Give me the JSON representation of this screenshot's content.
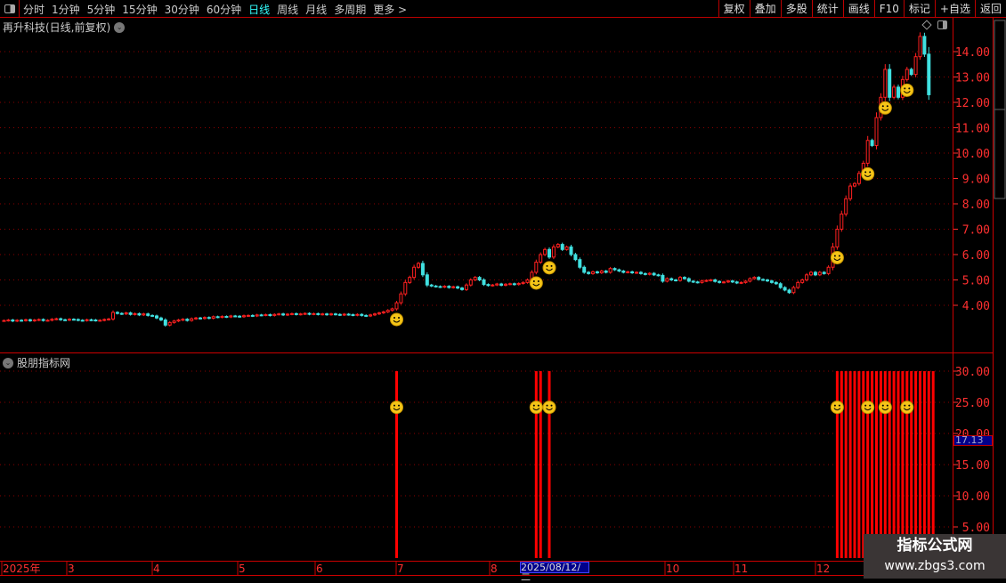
{
  "toolbar": {
    "periods": [
      "分时",
      "1分钟",
      "5分钟",
      "15分钟",
      "30分钟",
      "60分钟",
      "日线",
      "周线",
      "月线",
      "多周期",
      "更多 >"
    ],
    "active_period": "日线",
    "buttons": [
      "复权",
      "叠加",
      "多股",
      "统计",
      "画线",
      "F10",
      "标记",
      "+自选",
      "返回"
    ]
  },
  "main_pane": {
    "title": "再升科技(日线,前复权)",
    "price_axis": [
      "14.00",
      "13.00",
      "12.00",
      "11.00",
      "10.00",
      "9.00",
      "8.00",
      "7.00",
      "6.00",
      "5.00",
      "4.00"
    ],
    "colors": {
      "up": "#ff2020",
      "down": "#40e0e0",
      "grid": "#8b0000",
      "axis_text": "#ff3030"
    }
  },
  "indicator_pane": {
    "title": "股朋指标网",
    "axis": [
      "30.00",
      "25.00",
      "20.00",
      "15.00",
      "10.00",
      "5.00"
    ],
    "current_value": "17.13",
    "signal_value": 30,
    "bar_color": "#ff0000"
  },
  "x_axis": {
    "labels": [
      "2025年",
      "3",
      "4",
      "5",
      "6",
      "7",
      "8",
      "10",
      "11",
      "12"
    ],
    "cursor_date": "2025/08/12/二"
  },
  "watermark": {
    "name": "指标公式网",
    "url": "www.zbgs3.com"
  },
  "chart_data": {
    "type": "candlestick",
    "ylim": [
      3,
      15
    ],
    "closes": [
      3.4,
      3.42,
      3.38,
      3.41,
      3.4,
      3.43,
      3.39,
      3.42,
      3.44,
      3.4,
      3.41,
      3.45,
      3.47,
      3.43,
      3.42,
      3.45,
      3.44,
      3.41,
      3.4,
      3.43,
      3.42,
      3.4,
      3.41,
      3.44,
      3.46,
      3.72,
      3.68,
      3.66,
      3.7,
      3.64,
      3.67,
      3.62,
      3.66,
      3.6,
      3.58,
      3.5,
      3.42,
      3.22,
      3.32,
      3.38,
      3.42,
      3.45,
      3.4,
      3.47,
      3.5,
      3.48,
      3.52,
      3.49,
      3.55,
      3.53,
      3.56,
      3.54,
      3.58,
      3.57,
      3.55,
      3.59,
      3.6,
      3.58,
      3.62,
      3.61,
      3.63,
      3.6,
      3.64,
      3.66,
      3.62,
      3.65,
      3.67,
      3.64,
      3.66,
      3.68,
      3.65,
      3.67,
      3.64,
      3.66,
      3.63,
      3.66,
      3.64,
      3.62,
      3.65,
      3.63,
      3.61,
      3.64,
      3.6,
      3.58,
      3.62,
      3.66,
      3.7,
      3.74,
      3.8,
      3.86,
      4.1,
      4.45,
      4.9,
      5.1,
      5.5,
      5.65,
      5.2,
      4.8,
      4.76,
      4.74,
      4.72,
      4.75,
      4.7,
      4.73,
      4.68,
      4.62,
      4.8,
      5.0,
      5.1,
      5.0,
      4.82,
      4.78,
      4.8,
      4.84,
      4.79,
      4.83,
      4.85,
      4.82,
      4.86,
      4.9,
      5.0,
      5.3,
      5.7,
      6.0,
      6.2,
      5.9,
      6.3,
      6.4,
      6.2,
      6.3,
      6.0,
      5.8,
      5.5,
      5.3,
      5.25,
      5.32,
      5.28,
      5.35,
      5.3,
      5.45,
      5.4,
      5.35,
      5.3,
      5.32,
      5.28,
      5.3,
      5.25,
      5.22,
      5.26,
      5.2,
      5.18,
      4.95,
      5.05,
      5.0,
      4.98,
      5.1,
      5.05,
      4.95,
      4.92,
      4.9,
      4.96,
      4.98,
      5.0,
      4.94,
      4.9,
      4.92,
      4.96,
      4.92,
      4.88,
      4.9,
      4.95,
      5.05,
      5.1,
      5.02,
      5.0,
      4.96,
      4.9,
      4.85,
      4.7,
      4.6,
      4.5,
      4.7,
      4.9,
      5.0,
      5.2,
      5.3,
      5.2,
      5.3,
      5.25,
      5.5,
      6.3,
      7.0,
      7.6,
      8.2,
      8.7,
      8.8,
      9.2,
      9.6,
      10.5,
      10.3,
      11.4,
      12.2,
      13.3,
      12.2,
      12.6,
      12.2,
      12.9,
      13.3,
      13.1,
      13.8,
      14.6,
      13.9,
      12.3
    ],
    "smiley_signals": [
      90,
      122,
      125,
      191,
      198,
      202,
      207
    ],
    "indicator_bars": [
      90,
      122,
      123,
      125,
      191,
      192,
      193,
      194,
      195,
      196,
      197,
      198,
      199,
      200,
      201,
      202,
      203,
      204,
      205,
      206,
      207,
      208,
      209,
      210,
      211,
      212,
      213
    ]
  }
}
